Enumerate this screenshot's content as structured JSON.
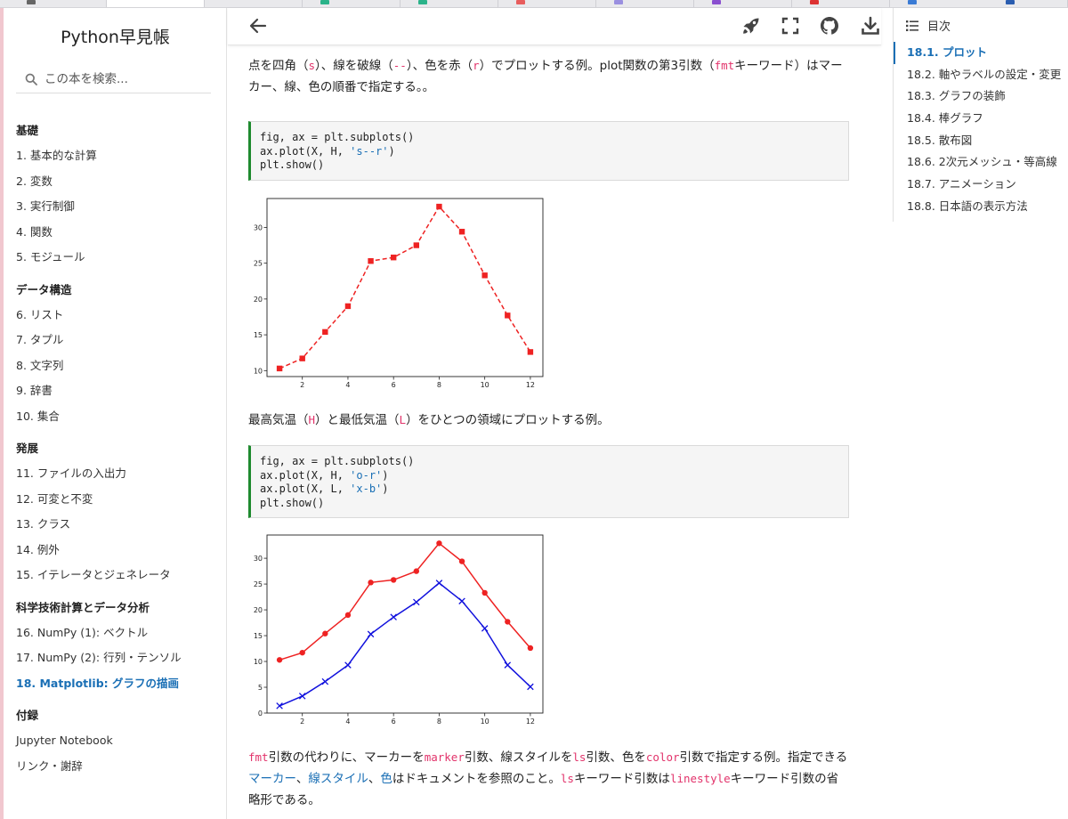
{
  "brand": "Python早見帳",
  "search": {
    "placeholder": "この本を検索..."
  },
  "sidebar": {
    "sections": [
      {
        "title": "基礎",
        "items": [
          "1. 基本的な計算",
          "2. 変数",
          "3. 実行制御",
          "4. 関数",
          "5. モジュール"
        ]
      },
      {
        "title": "データ構造",
        "items": [
          "6. リスト",
          "7. タプル",
          "8. 文字列",
          "9. 辞書",
          "10. 集合"
        ]
      },
      {
        "title": "発展",
        "items": [
          "11. ファイルの入出力",
          "12. 可変と不変",
          "13. クラス",
          "14. 例外",
          "15. イテレータとジェネレータ"
        ]
      },
      {
        "title": "科学技術計算とデータ分析",
        "items": [
          "16. NumPy (1): ベクトル",
          "17. NumPy (2): 行列・テンソル",
          "18. Matplotlib: グラフの描画"
        ]
      },
      {
        "title": "付録",
        "items": [
          "Jupyter Notebook",
          "リンク・謝辞"
        ]
      }
    ],
    "active_item": "18. Matplotlib: グラフの描画"
  },
  "toolbar": {
    "icons": [
      "arrow-left-icon",
      "rocket-icon",
      "fullscreen-icon",
      "github-icon",
      "download-icon"
    ]
  },
  "toc": {
    "title": "目次",
    "items": [
      "18.1. プロット",
      "18.2. 軸やラベルの設定・変更",
      "18.3. グラフの装飾",
      "18.4. 棒グラフ",
      "18.5. 散布図",
      "18.6. 2次元メッシュ・等高線",
      "18.7. アニメーション",
      "18.8. 日本語の表示方法"
    ],
    "active_index": 0
  },
  "content": {
    "para1": {
      "t1": "点を四角（",
      "c1": "s",
      "t2": "）、線を破線（",
      "c2": "--",
      "t3": "）、色を赤（",
      "c3": "r",
      "t4": "）でプロットする例。plot関数の第3引数（",
      "c4": "fmt",
      "t5": "キーワード）はマーカー、線、色の順番で指定する。。"
    },
    "code1": [
      "fig, ax = plt.subplots()",
      "ax.plot(X, H, ",
      "'s--r'",
      ")",
      "plt.show()"
    ],
    "para2": {
      "t1": "最高気温（",
      "c1": "H",
      "t2": "）と最低気温（",
      "c2": "L",
      "t3": "）をひとつの領域にプロットする例。"
    },
    "code2": [
      "fig, ax = plt.subplots()",
      "ax.plot(X, H, ",
      "'o-r'",
      ")",
      "ax.plot(X, L, ",
      "'x-b'",
      ")",
      "plt.show()"
    ],
    "para3": {
      "c1": "fmt",
      "t1": "引数の代わりに、マーカーを",
      "c2": "marker",
      "t2": "引数、線スタイルを",
      "c3": "ls",
      "t3": "引数、色を",
      "c4": "color",
      "t4": "引数で指定する例。指定できる",
      "l1": "マーカー",
      "t5": "、",
      "l2": "線スタイル",
      "t6": "、",
      "l3": "色",
      "t7": "はドキュメントを参照のこと。",
      "c5": "ls",
      "t8": "キーワード引数は",
      "c6": "linestyle",
      "t9": "キーワード引数の省略形である。"
    }
  },
  "chart_data": [
    {
      "type": "line",
      "x": [
        1,
        2,
        3,
        4,
        5,
        6,
        7,
        8,
        9,
        10,
        11,
        12
      ],
      "series": [
        {
          "values": [
            10.3,
            11.7,
            15.4,
            19.0,
            25.3,
            25.8,
            27.5,
            32.9,
            29.4,
            23.3,
            17.7,
            12.6
          ],
          "color": "#ee2222",
          "marker": "square",
          "linestyle": "dashed"
        }
      ],
      "xticks": [
        2,
        4,
        6,
        8,
        10,
        12
      ],
      "yticks": [
        10,
        15,
        20,
        25,
        30
      ],
      "xlim": [
        0.45,
        12.55
      ],
      "ylim": [
        9.17,
        34.03
      ],
      "grid": false
    },
    {
      "type": "line",
      "x": [
        1,
        2,
        3,
        4,
        5,
        6,
        7,
        8,
        9,
        10,
        11,
        12
      ],
      "series": [
        {
          "values": [
            10.3,
            11.7,
            15.4,
            19.0,
            25.3,
            25.8,
            27.5,
            32.9,
            29.4,
            23.3,
            17.7,
            12.6
          ],
          "color": "#ee2222",
          "marker": "circle",
          "linestyle": "solid"
        },
        {
          "values": [
            1.4,
            3.3,
            6.1,
            9.3,
            15.3,
            18.6,
            21.5,
            25.2,
            21.7,
            16.4,
            9.3,
            5.1
          ],
          "color": "#1111dd",
          "marker": "x",
          "linestyle": "solid"
        }
      ],
      "xticks": [
        2,
        4,
        6,
        8,
        10,
        12
      ],
      "yticks": [
        0,
        5,
        10,
        15,
        20,
        25,
        30
      ],
      "xlim": [
        0.45,
        12.55
      ],
      "ylim": [
        0,
        34.5
      ],
      "grid": false
    }
  ]
}
